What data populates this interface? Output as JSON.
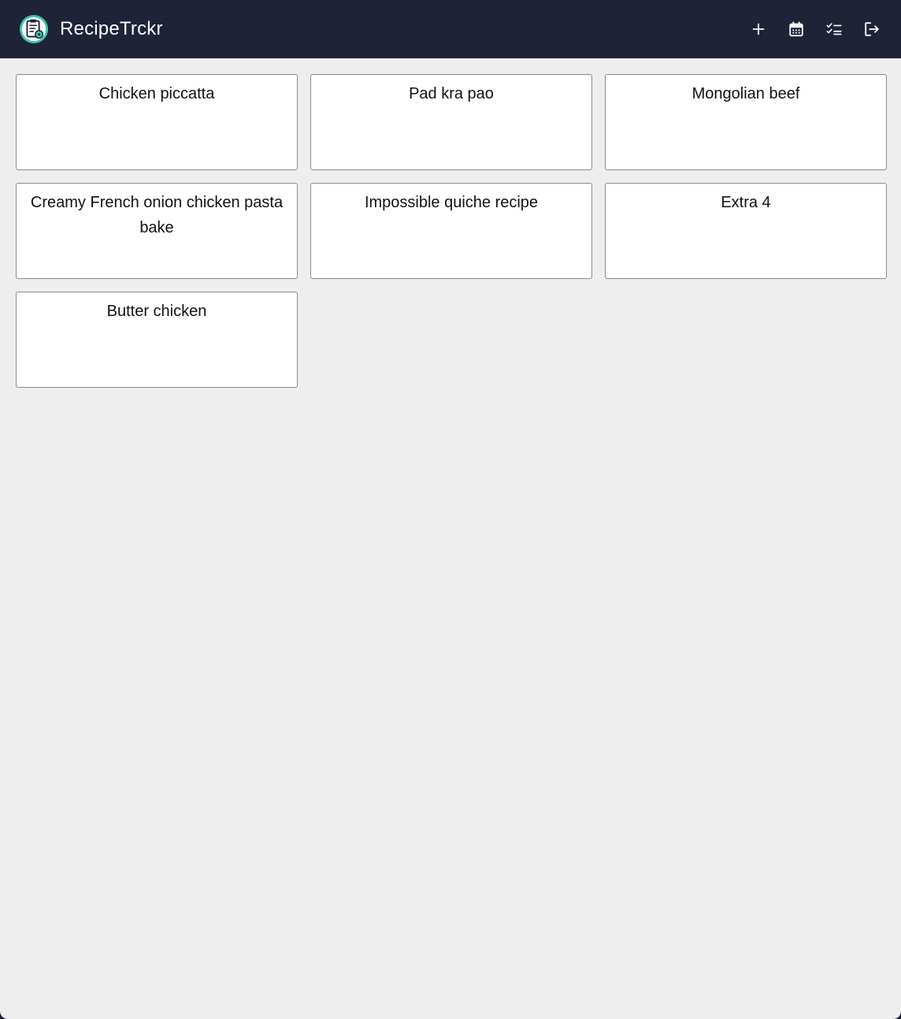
{
  "app": {
    "name": "RecipeTrckr",
    "logo_icon": "recipe-logo-icon"
  },
  "navbar": {
    "background": "#1e2338",
    "actions": [
      {
        "icon": "plus-icon",
        "label": "Add recipe"
      },
      {
        "icon": "calendar-icon",
        "label": "Meal plan"
      },
      {
        "icon": "checklist-icon",
        "label": "Shopping list"
      },
      {
        "icon": "logout-icon",
        "label": "Log out"
      }
    ]
  },
  "recipes": [
    {
      "title": "Chicken piccatta"
    },
    {
      "title": "Pad kra pao"
    },
    {
      "title": "Mongolian beef"
    },
    {
      "title": "Creamy French onion chicken pasta bake"
    },
    {
      "title": "Impossible quiche recipe"
    },
    {
      "title": "Extra 4"
    },
    {
      "title": "Butter chicken"
    }
  ]
}
